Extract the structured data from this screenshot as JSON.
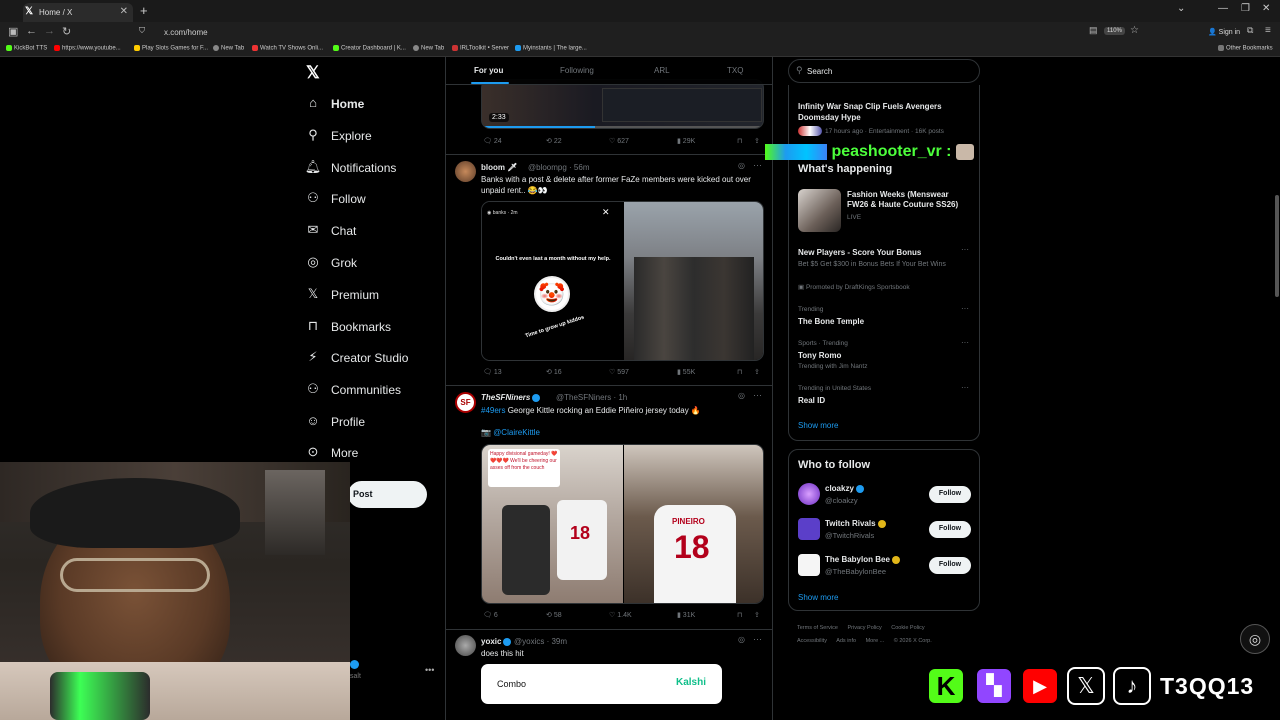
{
  "browser": {
    "tab_title": "Home / X",
    "url": "x.com/home",
    "zoom": "110%",
    "signin": "Sign in",
    "bookmarks": [
      "KickBot TTS",
      "https://www.youtube...",
      "Play Slots Games for F...",
      "New Tab",
      "Watch TV Shows Onli...",
      "Creator Dashboard | K...",
      "New Tab",
      "IRLToolkit • Server",
      "Myinstants | The large..."
    ],
    "other_bookmarks": "Other Bookmarks"
  },
  "nav": {
    "items": [
      "Home",
      "Explore",
      "Notifications",
      "Follow",
      "Chat",
      "Grok",
      "Premium",
      "Bookmarks",
      "Creator Studio",
      "Communities",
      "Profile",
      "More"
    ],
    "post_label": "Post",
    "account_handle": "salt"
  },
  "feed": {
    "tabs": [
      "For you",
      "Following",
      "ARL",
      "TXQ"
    ],
    "tweet0": {
      "video_duration": "2:33",
      "replies": "24",
      "retweets": "22",
      "likes": "627",
      "views": "29K"
    },
    "tweet1": {
      "name": "bloom",
      "badge": "🗡",
      "handle": "@bloompg · 56m",
      "text": "Banks with a post & delete after former FaZe members were kicked out over unpaid rent.. 😂👀",
      "story_user": "banks",
      "story_time": "2m",
      "story_text": "Couldn't even last a month without my help.",
      "story_caption": "Time to grow up kiddos",
      "replies": "13",
      "retweets": "16",
      "likes": "597",
      "views": "55K"
    },
    "tweet2": {
      "name": "TheSFNiners",
      "handle": "@TheSFNiners · 1h",
      "hashtag": "#49ers",
      "text": "George Kittle rocking an Eddie Piñeiro jersey today 🔥",
      "mention": "@ClaireKittle",
      "sign_text": "Happy divisional gameday! ❤️❤️❤️❤️ We'll be cheering our asses off from the couch",
      "jersey_number": "18",
      "jersey_name": "PINEIRO",
      "replies": "6",
      "retweets": "58",
      "likes": "1.4K",
      "views": "31K"
    },
    "tweet3": {
      "name": "yoxic",
      "handle": "@yoxics · 39m",
      "text": "does this hit",
      "card_left": "Combo",
      "card_right": "Kalshi"
    }
  },
  "right": {
    "search_placeholder": "Search",
    "top_trend": {
      "title": "Infinity War Snap Clip Fuels Avengers Doomsday Hype",
      "meta": "17 hours ago · Entertainment · 16K posts"
    },
    "whats_happening": "What's happening",
    "event": {
      "title": "Fashion Weeks (Menswear FW26 & Haute Couture SS26)",
      "status": "LIVE"
    },
    "promo": {
      "title": "New Players - Score Your Bonus",
      "text": "Bet $5 Get $300 in Bonus Bets If Your Bet Wins",
      "by": "Promoted by DraftKings Sportsbook"
    },
    "trends": [
      {
        "context": "Trending",
        "name": "The Bone Temple",
        "extra": ""
      },
      {
        "context": "Sports · Trending",
        "name": "Tony Romo",
        "extra": "Trending with Jim Nantz"
      },
      {
        "context": "Trending in United States",
        "name": "Real ID",
        "extra": ""
      }
    ],
    "show_more": "Show more",
    "who_to_follow": "Who to follow",
    "suggestions": [
      {
        "name": "cloakzy",
        "handle": "@cloakzy",
        "color": "#8b5cf6"
      },
      {
        "name": "Twitch Rivals",
        "handle": "@TwitchRivals",
        "color": "#6441a5"
      },
      {
        "name": "The Babylon Bee",
        "handle": "@TheBabylonBee",
        "color": "#f5f5f5"
      }
    ],
    "follow_label": "Follow",
    "footer": [
      "Terms of Service",
      "Privacy Policy",
      "Cookie Policy",
      "Accessibility",
      "Ads info",
      "More ...",
      "© 2026 X Corp."
    ]
  },
  "stream": {
    "chat_user": "peashooter_vr :",
    "brand": "T3QQ13"
  },
  "colors": {
    "accent": "#1d9bf0",
    "kick": "#53fc18",
    "twitch": "#9146ff",
    "youtube": "#ff0000"
  }
}
